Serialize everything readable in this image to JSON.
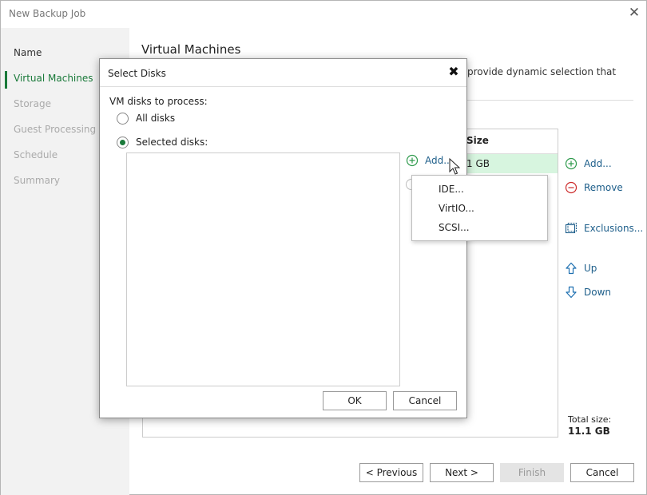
{
  "window": {
    "title": "New Backup Job",
    "close_glyph": "✕"
  },
  "sidebar": {
    "steps": [
      {
        "label": "Name",
        "state": "done"
      },
      {
        "label": "Virtual Machines",
        "state": "active"
      },
      {
        "label": "Storage",
        "state": "pending"
      },
      {
        "label": "Guest Processing",
        "state": "pending"
      },
      {
        "label": "Schedule",
        "state": "pending"
      },
      {
        "label": "Summary",
        "state": "pending"
      }
    ]
  },
  "main": {
    "title": "Virtual Machines",
    "description": "provide dynamic selection that",
    "grid": {
      "size_header": "Size",
      "rows": [
        {
          "size": "1 GB"
        }
      ]
    },
    "side_buttons": {
      "add": "Add...",
      "remove": "Remove",
      "exclusions": "Exclusions...",
      "up": "Up",
      "down": "Down"
    },
    "total_label": "Total size:",
    "total_value": "11.1 GB"
  },
  "footer": {
    "previous": "< Previous",
    "next": "Next >",
    "finish": "Finish",
    "cancel": "Cancel"
  },
  "dialog": {
    "title": "Select Disks",
    "close_glyph": "✖",
    "process_label": "VM disks to process:",
    "option_all": "All disks",
    "option_selected": "Selected disks:",
    "selected_option": "Selected disks:",
    "add_label": "Add...",
    "ok": "OK",
    "cancel": "Cancel"
  },
  "add_menu": {
    "items": [
      "IDE...",
      "VirtIO...",
      "SCSI..."
    ]
  },
  "colors": {
    "accent_green": "#1a7a3a",
    "link_blue": "#1d5e8a",
    "selection_row": "#d7f5df",
    "sidebar_bg": "#f2f2f2"
  }
}
